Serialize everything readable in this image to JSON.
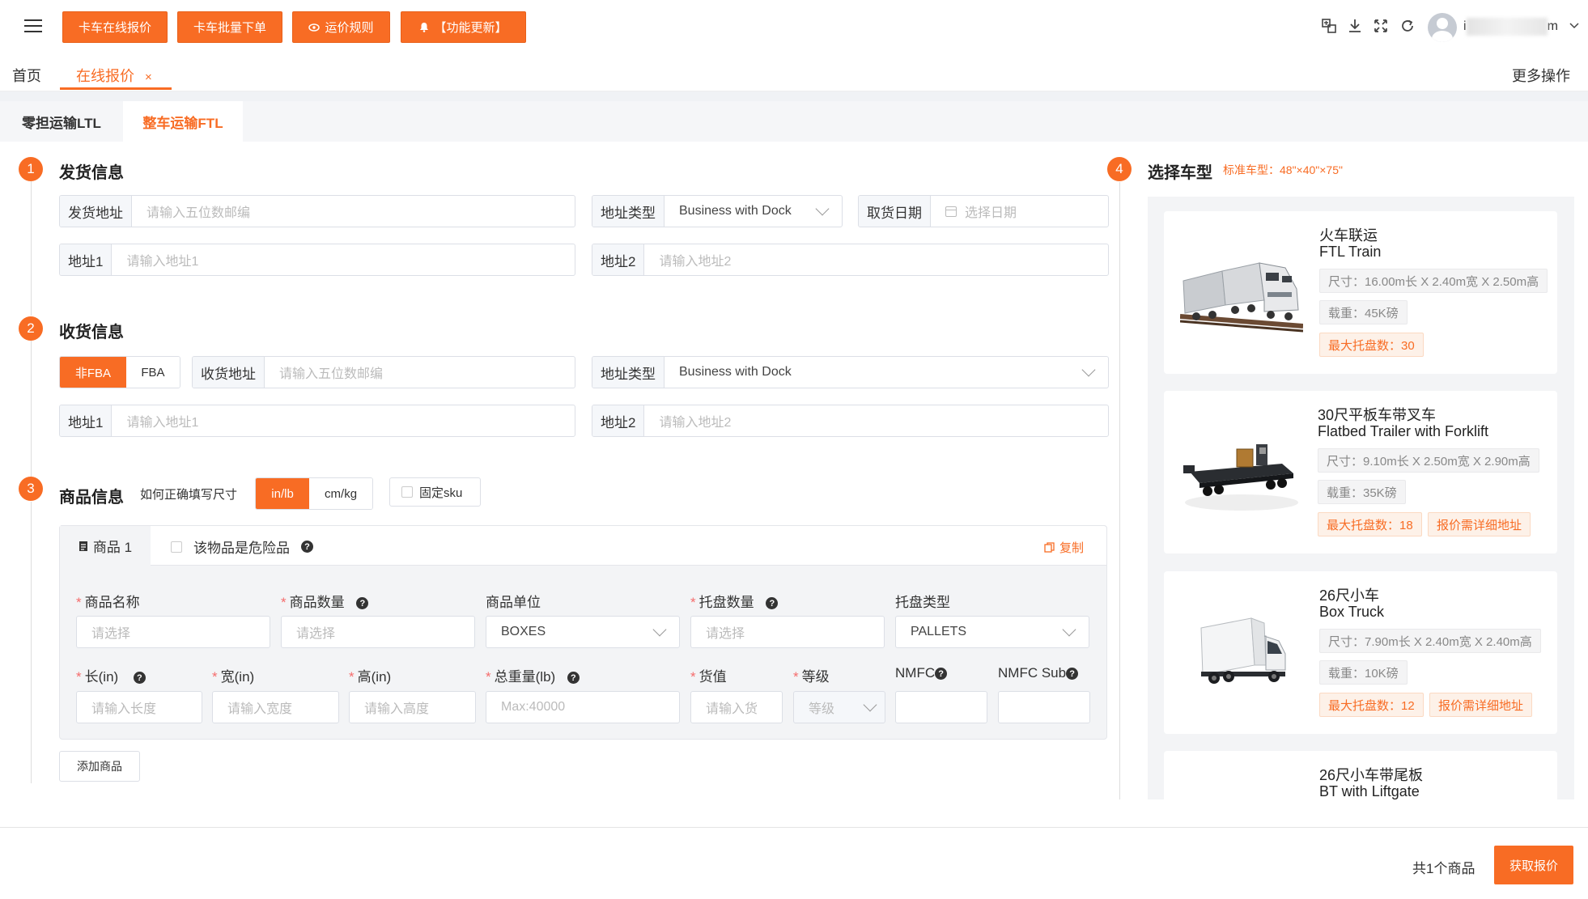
{
  "toolbar": {
    "buttons": [
      {
        "label": "卡车在线报价",
        "icon": ""
      },
      {
        "label": "卡车批量下单",
        "icon": ""
      },
      {
        "label": "运价规则",
        "icon": "eye-icon"
      },
      {
        "label": "【功能更新】",
        "icon": "bell-icon"
      }
    ],
    "username_suffix": "m"
  },
  "nav": {
    "home": "首页",
    "active_tab": "在线报价",
    "close": "×",
    "more": "更多操作"
  },
  "subtabs": {
    "ltl": "零担运输LTL",
    "ftl": "整车运输FTL"
  },
  "shipper": {
    "step": "1",
    "title": "发货信息",
    "origin_label": "发货地址",
    "origin_placeholder": "请输入五位数邮编",
    "addr_type_label": "地址类型",
    "addr_type_value": "Business with Dock",
    "pickup_label": "取货日期",
    "pickup_placeholder": "选择日期",
    "addr1_label": "地址1",
    "addr1_placeholder": "请输入地址1",
    "addr2_label": "地址2",
    "addr2_placeholder": "请输入地址2"
  },
  "receiver": {
    "step": "2",
    "title": "收货信息",
    "non_fba": "非FBA",
    "fba": "FBA",
    "dest_label": "收货地址",
    "dest_placeholder": "请输入五位数邮编",
    "addr_type_label": "地址类型",
    "addr_type_value": "Business with Dock",
    "addr1_label": "地址1",
    "addr1_placeholder": "请输入地址1",
    "addr2_label": "地址2",
    "addr2_placeholder": "请输入地址2"
  },
  "goods": {
    "step": "3",
    "title": "商品信息",
    "help": "如何正确填写尺寸",
    "unit_imperial": "in/lb",
    "unit_metric": "cm/kg",
    "fixed_sku": "固定sku",
    "item_tab": "商品 1",
    "dangerous": "该物品是危险品",
    "copy": "复制",
    "fields": {
      "name_label": "商品名称",
      "name_placeholder": "请选择",
      "qty_label": "商品数量",
      "qty_placeholder": "请选择",
      "unit_label": "商品单位",
      "unit_value": "BOXES",
      "pallet_qty_label": "托盘数量",
      "pallet_qty_placeholder": "请选择",
      "pallet_type_label": "托盘类型",
      "pallet_type_value": "PALLETS",
      "length_label": "长(in)",
      "length_placeholder": "请输入长度",
      "width_label": "宽(in)",
      "width_placeholder": "请输入宽度",
      "height_label": "高(in)",
      "height_placeholder": "请输入高度",
      "weight_label": "总重量(lb)",
      "weight_placeholder": "Max:40000",
      "value_label": "货值",
      "value_placeholder": "请输入货",
      "class_label": "等级",
      "class_placeholder": "等级",
      "nmfc_label": "NMFC",
      "nmfc_sub_label": "NMFC Sub"
    },
    "add_item": "添加商品"
  },
  "vehicle": {
    "step": "4",
    "title": "选择车型",
    "standard": "标准车型：48\"×40\"×75\"",
    "cards": [
      {
        "cn": "火车联运",
        "en": "FTL Train",
        "size": "尺寸：16.00m长 X 2.40m宽 X 2.50m高",
        "load": "载重：45K磅",
        "pallets": "最大托盘数：30",
        "note": ""
      },
      {
        "cn": "30尺平板车带叉车",
        "en": "Flatbed Trailer with Forklift",
        "size": "尺寸：9.10m长 X 2.50m宽 X 2.90m高",
        "load": "载重：35K磅",
        "pallets": "最大托盘数：18",
        "note": "报价需详细地址"
      },
      {
        "cn": "26尺小车",
        "en": "Box Truck",
        "size": "尺寸：7.90m长 X 2.40m宽 X 2.40m高",
        "load": "载重：10K磅",
        "pallets": "最大托盘数：12",
        "note": "报价需详细地址"
      },
      {
        "cn": "26尺小车带尾板",
        "en": "BT with Liftgate"
      }
    ]
  },
  "footer": {
    "total": "共1个商品",
    "quote": "获取报价"
  },
  "colors": {
    "accent": "#f86c24",
    "required": "#f56c6c"
  }
}
